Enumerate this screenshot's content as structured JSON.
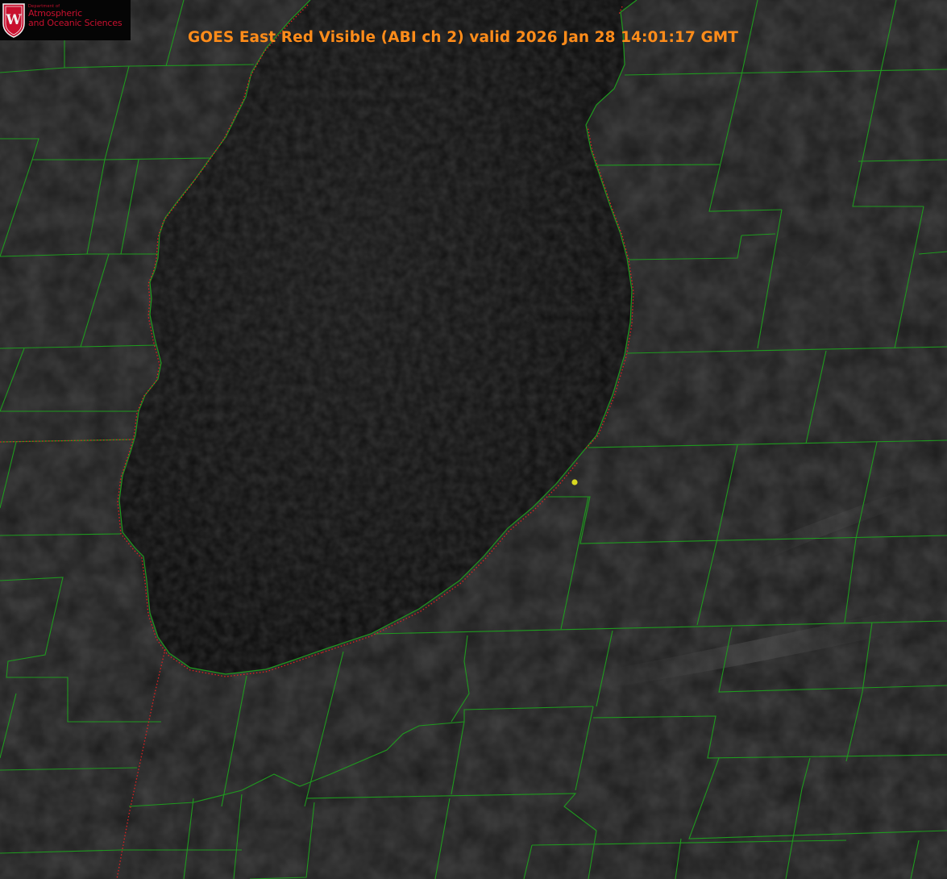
{
  "title": "GOES East Red Visible (ABI ch 2) valid 2026 Jan 28 14:01:17 GMT",
  "logo": {
    "department": "Department of",
    "line1": "Atmospheric",
    "line2": "and Oceanic Sciences",
    "crest_letter": "W",
    "color": "#c8102e"
  },
  "colors": {
    "title": "#ff8c1a",
    "county_lines": "#1f9a1f",
    "state_line": "#e02020",
    "lake": "#0d0d0d",
    "land": "#1e1e1e",
    "station_marker": "#d8d820"
  }
}
